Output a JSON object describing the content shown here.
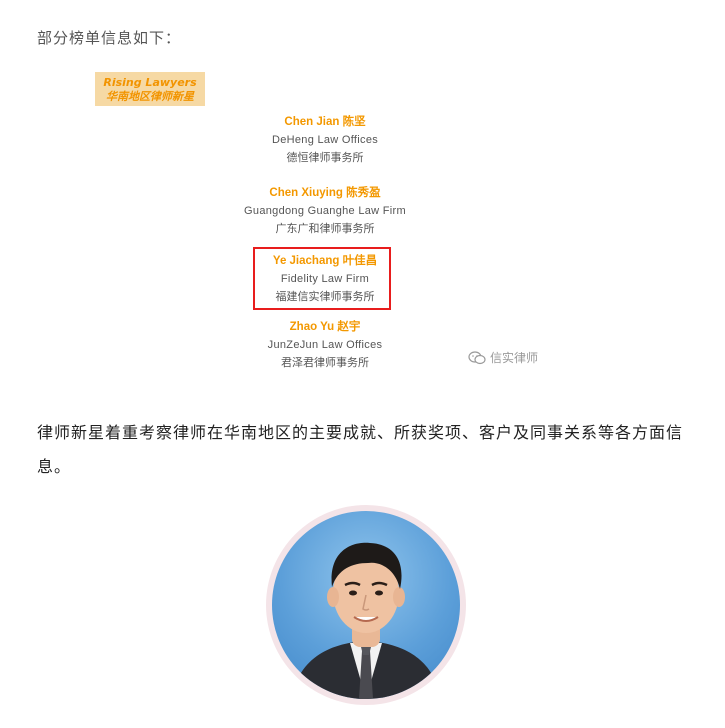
{
  "intro_text": "部分榜单信息如下：",
  "banner": {
    "title_en": "Rising Lawyers",
    "title_zh": "华南地区律师新星"
  },
  "entries": [
    {
      "name": "Chen Jian 陈坚",
      "firm_en": "DeHeng Law Offices",
      "firm_zh": "德恒律师事务所"
    },
    {
      "name": "Chen Xiuying 陈秀盈",
      "firm_en": "Guangdong Guanghe Law Firm",
      "firm_zh": "广东广和律师事务所"
    },
    {
      "name": "Ye Jiachang 叶佳昌",
      "firm_en": "Fidelity Law Firm",
      "firm_zh": "福建信实律师事务所"
    },
    {
      "name": "Zhao Yu 赵宇",
      "firm_en": "JunZeJun Law Offices",
      "firm_zh": "君泽君律师事务所"
    }
  ],
  "highlighted_entry": "Ye Jiachang 叶佳昌",
  "watermark": "信实律师",
  "body_text": "律师新星着重考察律师在华南地区的主要成就、所获奖项、客户及同事关系等各方面信息。",
  "colors": {
    "accent_orange": "#f39800",
    "banner_bg": "#f6d9a4",
    "highlight_red": "#e81d1d"
  },
  "icons": [
    "wechat-watermark-icon"
  ]
}
